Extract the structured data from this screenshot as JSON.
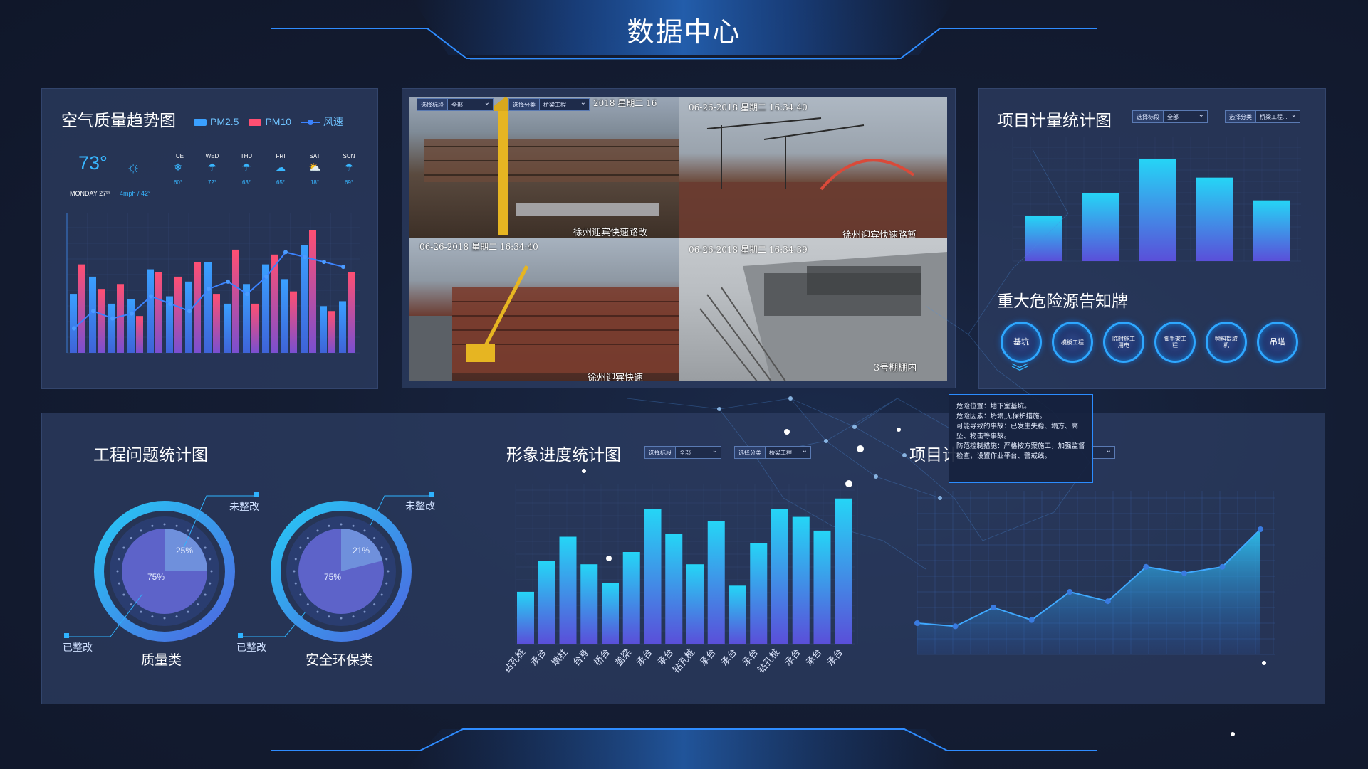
{
  "header": {
    "title": "数据中心"
  },
  "colors": {
    "accent": "#2fb3ff",
    "pm25": "#3aa0ff",
    "pm10": "#ff4f72",
    "line": "#3b83ff",
    "bar_top": "#25d5f6",
    "bar_bottom": "#5a4fd9"
  },
  "air_panel": {
    "title": "空气质量趋势图",
    "legend": [
      {
        "label": "PM2.5",
        "color": "#3aa0ff"
      },
      {
        "label": "PM10",
        "color": "#ff4f72"
      },
      {
        "label": "风速",
        "color": "#3b83ff"
      }
    ],
    "weather": {
      "temp": "73°",
      "today": "MONDAY 27ᵗʰ",
      "wind": "4mph / 42°",
      "days": [
        {
          "name": "TUE",
          "icon": "snow-icon",
          "temp": "60°"
        },
        {
          "name": "WED",
          "icon": "rain-cloud-icon",
          "temp": "72°"
        },
        {
          "name": "THU",
          "icon": "rain-cloud-icon",
          "temp": "63°"
        },
        {
          "name": "FRI",
          "icon": "cloud-icon",
          "temp": "65°"
        },
        {
          "name": "SAT",
          "icon": "sun-cloud-icon",
          "temp": "18°"
        },
        {
          "name": "SUN",
          "icon": "rain-cloud-icon",
          "temp": "69°"
        }
      ]
    }
  },
  "video_panel": {
    "filters": [
      {
        "label": "选择标段",
        "value": "全部"
      },
      {
        "label": "选择分类",
        "value": "桥梁工程"
      }
    ],
    "cams": [
      {
        "timestamp": "2018  星期二  16",
        "caption": "徐州迎宾快速路改"
      },
      {
        "timestamp": "06-26-2018  星期二  16:34:40",
        "caption": "徐州迎宾快速路堑"
      },
      {
        "timestamp": "06-26-2018  星期二  16:34:40",
        "caption": "徐州迎宾快速"
      },
      {
        "timestamp": "06-26-2018  星期二  16:34:39",
        "caption": "3号棚棚内"
      }
    ]
  },
  "measure_panel": {
    "title": "项目计量统计图",
    "filters": [
      {
        "label": "选择标段",
        "value": "全部"
      },
      {
        "label": "选择分类",
        "value": "桥梁工程..."
      }
    ]
  },
  "hazard_panel": {
    "title": "重大危险源告知牌",
    "items": [
      "基坑",
      "模板工程",
      "临时施工用电",
      "脚手架工程",
      "物料提取机",
      "吊塔"
    ]
  },
  "tooltip": {
    "lines": [
      "危险位置：地下室基坑。",
      "危险因素：坍塌,无保护措施。",
      "可能导致的事故：已发生失稳、塌方、高坠、物击等事故。",
      "防范控制措施：严格按方案施工，加强监督检查，设置作业平台、警戒线。"
    ]
  },
  "issue_panel": {
    "title": "工程问题统计图",
    "donuts": [
      {
        "name": "质量类",
        "unfixed_label": "未整改",
        "fixed_label": "已整改",
        "unfixed_pct": "25%",
        "fixed_pct": "75%",
        "unfixed_value": 25
      },
      {
        "name": "安全环保类",
        "unfixed_label": "未整改",
        "fixed_label": "已整改",
        "unfixed_pct": "21%",
        "fixed_pct": "75%",
        "unfixed_value": 21
      }
    ]
  },
  "progress_panel": {
    "title": "形象进度统计图",
    "filters": [
      {
        "label": "选择标段",
        "value": "全部"
      },
      {
        "label": "选择分类",
        "value": "桥梁工程"
      }
    ]
  },
  "right_bottom_panel": {
    "title_visible": "项目计"
  },
  "chart_data": [
    {
      "type": "bar",
      "title": "空气质量趋势图",
      "series": [
        {
          "name": "PM2.5",
          "values": [
            48,
            62,
            40,
            44,
            68,
            46,
            58,
            74,
            40,
            56,
            72,
            60,
            88,
            38,
            42
          ]
        },
        {
          "name": "PM10",
          "values": [
            72,
            52,
            56,
            30,
            66,
            62,
            74,
            48,
            84,
            40,
            80,
            50,
            100,
            34,
            66
          ]
        },
        {
          "name": "风速",
          "values": [
            20,
            34,
            28,
            32,
            46,
            40,
            34,
            52,
            58,
            48,
            62,
            82,
            78,
            74,
            70
          ]
        }
      ],
      "ylim": [
        0,
        110
      ]
    },
    {
      "type": "bar",
      "title": "项目计量统计图",
      "values": [
        48,
        72,
        108,
        88,
        64
      ],
      "ylim": [
        0,
        120
      ]
    },
    {
      "type": "bar",
      "title": "形象进度统计图",
      "categories": [
        "钻孔桩",
        "承台",
        "墩柱",
        "台身",
        "桥台",
        "盖梁",
        "承台",
        "承台",
        "钻孔桩",
        "承台",
        "承台",
        "承台",
        "钻孔桩",
        "承台",
        "承台",
        "承台"
      ],
      "values": [
        34,
        54,
        70,
        52,
        40,
        60,
        88,
        72,
        52,
        80,
        38,
        66,
        88,
        83,
        74,
        95
      ],
      "ylim": [
        0,
        100
      ]
    },
    {
      "type": "area",
      "title": "",
      "values": [
        20,
        18,
        30,
        22,
        40,
        34,
        56,
        52,
        56,
        80
      ],
      "ylim": [
        0,
        100
      ]
    }
  ]
}
